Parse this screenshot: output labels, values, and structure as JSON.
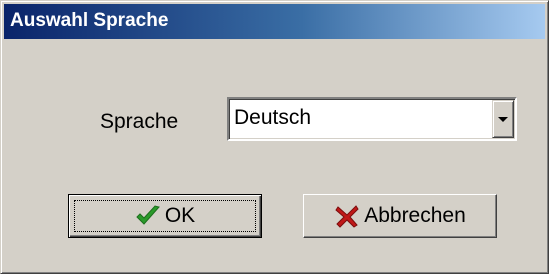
{
  "window": {
    "title": "Auswahl Sprache"
  },
  "form": {
    "language_label": "Sprache",
    "language_select": {
      "value": "Deutsch"
    }
  },
  "buttons": {
    "ok": {
      "label": "OK",
      "icon": "checkmark-icon",
      "icon_color": "#2a9a2a"
    },
    "cancel": {
      "label": "Abbrechen",
      "icon": "x-icon",
      "icon_color": "#c01818"
    }
  },
  "colors": {
    "title_gradient_start": "#0a246a",
    "title_gradient_end": "#a6caf0",
    "window_face": "#d4d0c8"
  }
}
